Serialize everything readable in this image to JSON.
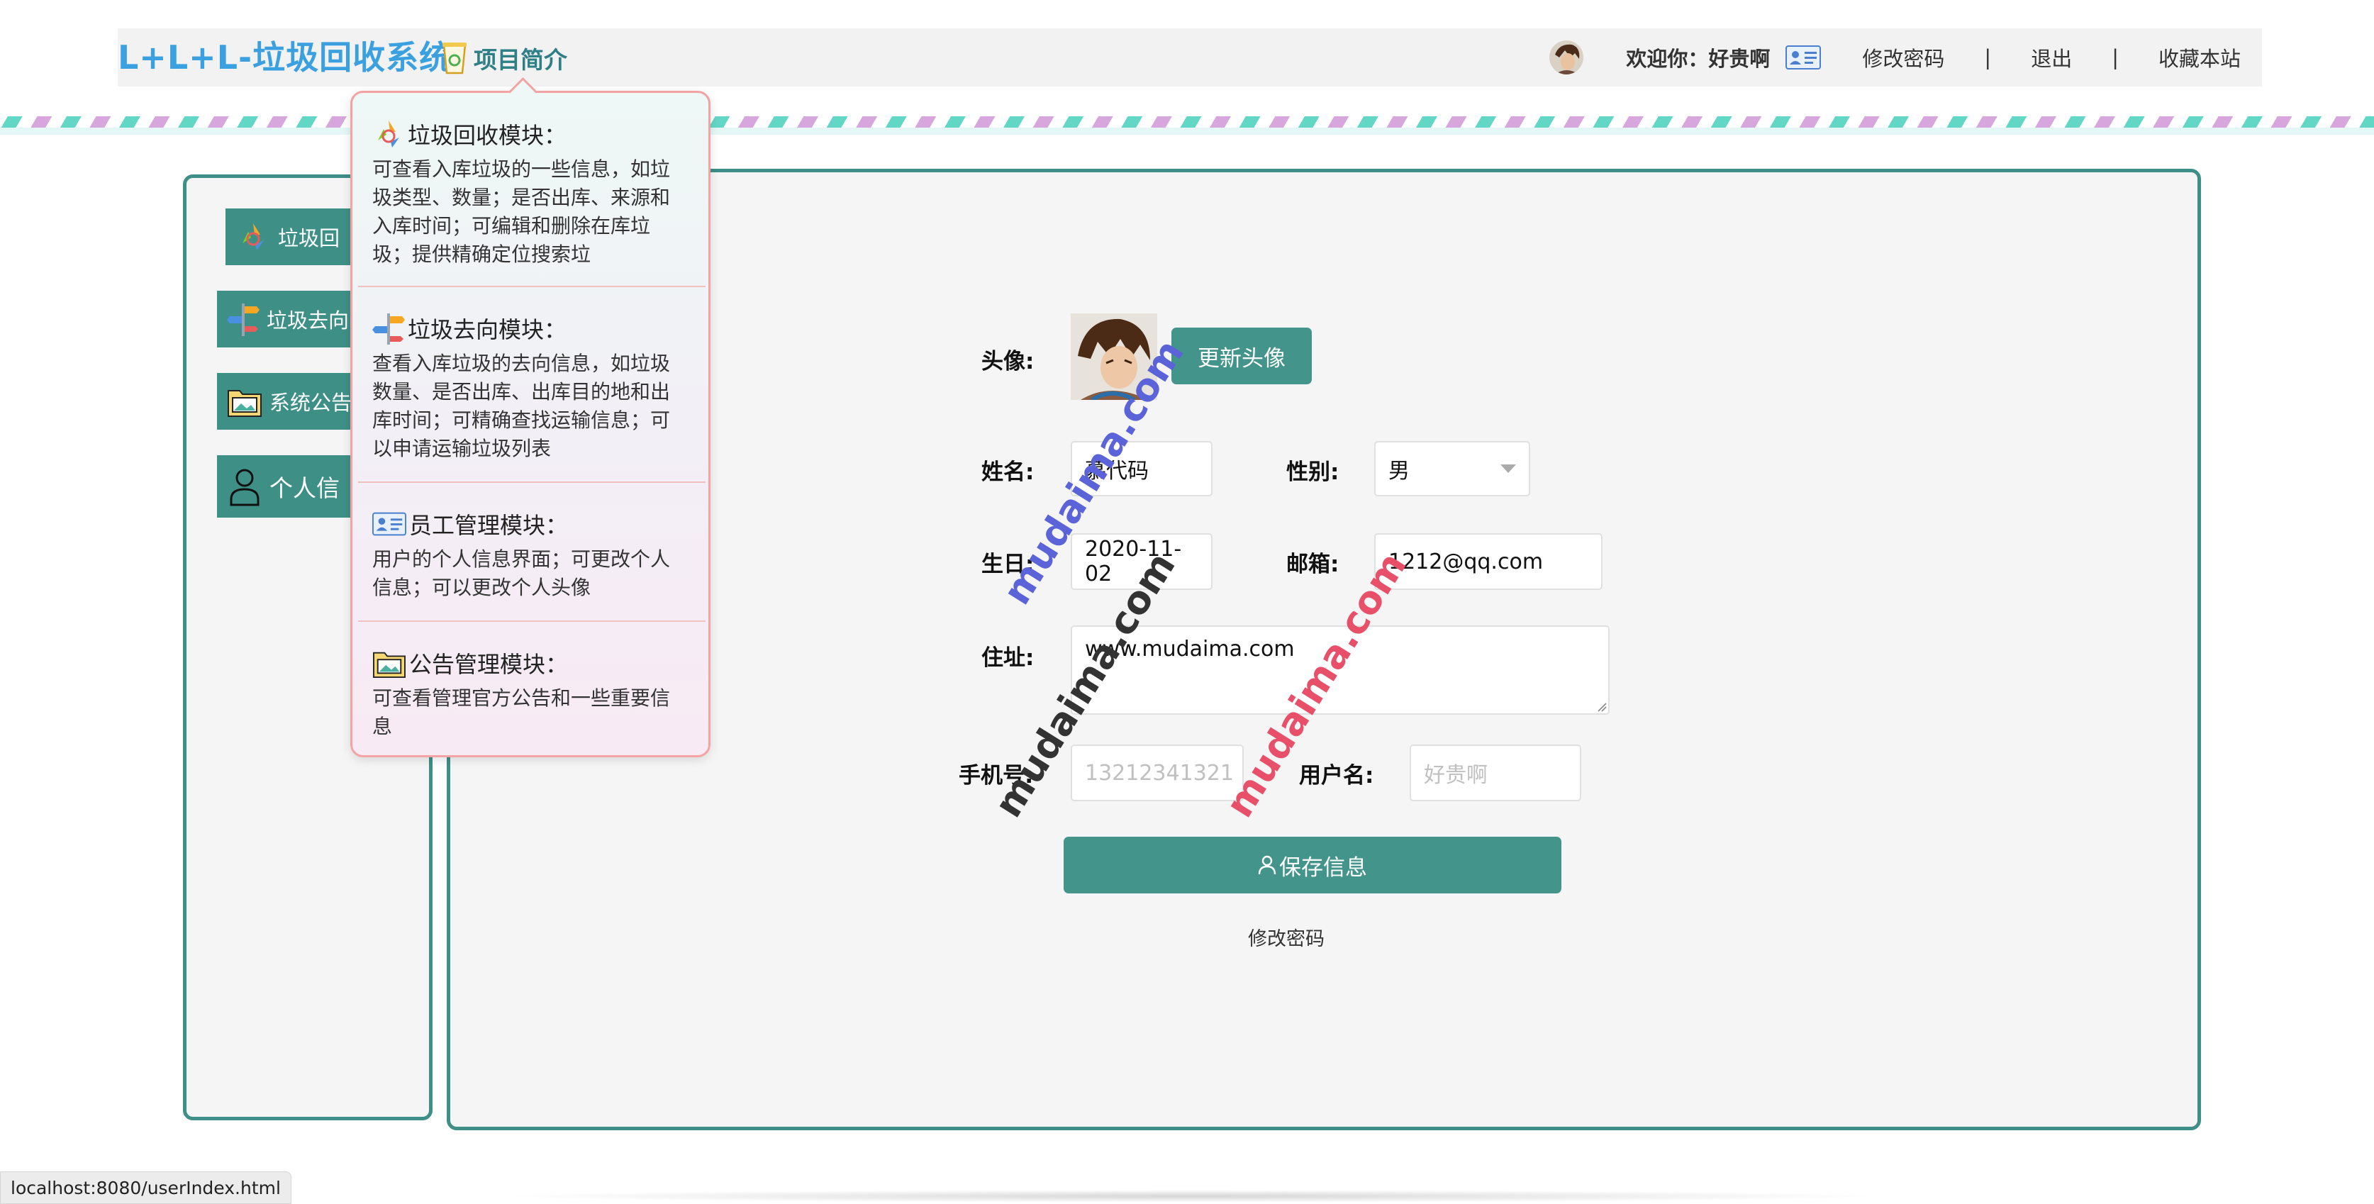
{
  "header": {
    "logo": "L+L+L-垃圾回收系统",
    "intro_link": "项目简介",
    "welcome": "欢迎你：好贵啊",
    "change_password": "修改密码",
    "separator": "|",
    "logout": "退出",
    "bookmark": "收藏本站"
  },
  "sidebar": {
    "items": [
      {
        "label": "垃圾回"
      },
      {
        "label": "垃圾去向"
      },
      {
        "label": "系统公告"
      },
      {
        "label": "个人信"
      }
    ]
  },
  "popup": {
    "modules": [
      {
        "title": "垃圾回收模块：",
        "desc": "可查看入库垃圾的一些信息，如垃圾类型、数量；是否出库、来源和入库时间；可编辑和删除在库垃圾；提供精确定位搜索垃"
      },
      {
        "title": "垃圾去向模块：",
        "desc": "查看入库垃圾的去向信息，如垃圾数量、是否出库、出库目的地和出库时间；可精确查找运输信息；可以申请运输垃圾列表"
      },
      {
        "title": "员工管理模块：",
        "desc": "用户的个人信息界面；可更改个人信息；可以更改个人头像"
      },
      {
        "title": "公告管理模块：",
        "desc": "可查看管理官方公告和一些重要信息"
      }
    ]
  },
  "form": {
    "avatar_label": "头像:",
    "update_avatar": "更新头像",
    "name_label": "姓名:",
    "name_value": "慕代码",
    "gender_label": "性别:",
    "gender_value": "男",
    "birthday_label": "生日:",
    "birthday_value": "2020-11-02",
    "email_label": "邮箱:",
    "email_value": "1212@qq.com",
    "address_label": "住址:",
    "address_value": "www.mudaima.com",
    "phone_label": "手机号:",
    "phone_placeholder": "13212341321",
    "username_label": "用户名:",
    "username_placeholder": "好贵啊",
    "save_button": "保存信息",
    "change_password": "修改密码"
  },
  "watermarks": [
    "mudaima.com",
    "mudaima.com",
    "mudaima.com"
  ],
  "status_bar": "localhost:8080/userIndex.html",
  "colors": {
    "accent": "#43948a",
    "logo": "#3aa0e0",
    "panel_border": "#3d8f87",
    "watermark_blue": "#5b63d8",
    "watermark_red": "#e8506a",
    "watermark_dark": "#333333"
  }
}
